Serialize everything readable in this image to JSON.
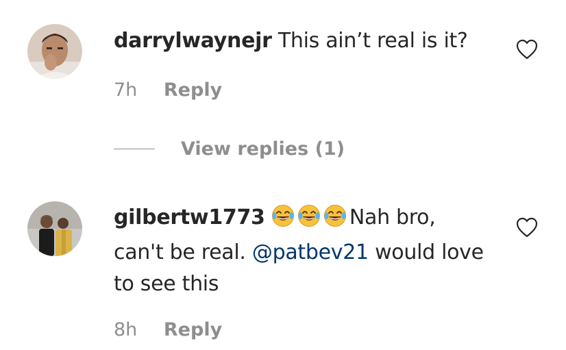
{
  "comments": [
    {
      "username": "darrylwaynejr",
      "text": "This ain’t real is it?",
      "time": "7h",
      "reply_label": "Reply",
      "like_icon": "heart-outline-icon",
      "view_replies": "View replies (1)"
    },
    {
      "username": "gilbertw1773",
      "emojis": [
        "face-with-tears-of-joy",
        "face-with-tears-of-joy",
        "face-with-tears-of-joy"
      ],
      "text_before": "Nah bro, can't be real. ",
      "mention": "@patbev21",
      "text_after": " would love to see this",
      "time": "8h",
      "reply_label": "Reply",
      "like_icon": "heart-outline-icon"
    }
  ],
  "colors": {
    "text": "#262626",
    "secondary": "#8e8e8e",
    "mention": "#00376b"
  }
}
